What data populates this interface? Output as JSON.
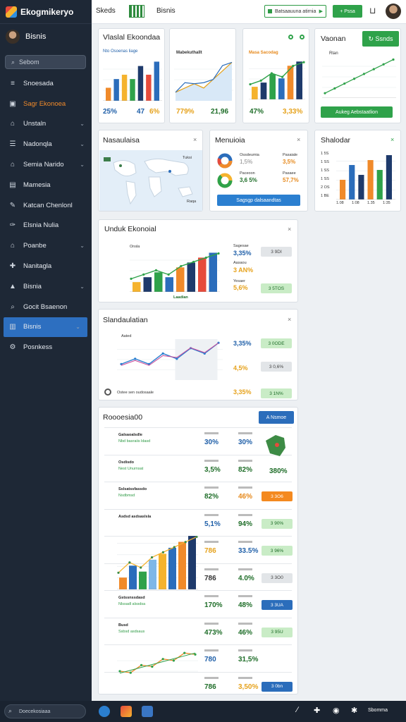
{
  "app": {
    "name": "Ekogmikeryo"
  },
  "profile": {
    "name": "Bisnis"
  },
  "sidebar": {
    "search_placeholder": "Sebom",
    "items": [
      {
        "label": "Snoesada",
        "icon": "list-icon"
      },
      {
        "label": "Sagr Ekonoea",
        "icon": "layers-icon"
      },
      {
        "label": "Unstaln",
        "icon": "home-icon"
      },
      {
        "label": "Nadonqla",
        "icon": "menu-icon"
      },
      {
        "label": "Semia Narido",
        "icon": "home-icon"
      },
      {
        "label": "Mamesia",
        "icon": "grid-icon"
      },
      {
        "label": "Katcan Chenlonl",
        "icon": "pen-icon"
      },
      {
        "label": "Elsnia Nulia",
        "icon": "pin-icon"
      },
      {
        "label": "Poanbe",
        "icon": "house-icon"
      },
      {
        "label": "Nanitagla",
        "icon": "puzzle-icon"
      },
      {
        "label": "Bisnia",
        "icon": "cap-icon"
      },
      {
        "label": "Gocit Bsaenon",
        "icon": "search-icon"
      },
      {
        "label": "Bisnis",
        "icon": "chart-icon"
      },
      {
        "label": "Posnkess",
        "icon": "gear-icon"
      }
    ]
  },
  "topbar": {
    "title": "Skeds",
    "page": "Bisnis",
    "input_value": "Batsaauuna atirnia",
    "action_label": "Pssa"
  },
  "cards": {
    "card1": {
      "title": "Vlaslal Ekoondaa",
      "subtitle": "Nto Osoenas liage",
      "values": [
        "25%",
        "47",
        "6%"
      ],
      "chart": {
        "type": "bar",
        "values": [
          3,
          5,
          6,
          5,
          8,
          6,
          9
        ]
      }
    },
    "card2": {
      "title": "Mabekuthallt",
      "values": [
        "779%",
        "21,96"
      ],
      "chart": {
        "type": "area",
        "values": [
          2,
          3,
          4,
          3,
          5,
          7,
          9
        ]
      }
    },
    "card3": {
      "title": "Masa Sacodag",
      "values": [
        "47%",
        "3,33%"
      ],
      "chart": {
        "type": "bar+line",
        "values": [
          3,
          4,
          6,
          5,
          8,
          9
        ]
      }
    },
    "card4": {
      "title": "Vaonan",
      "button": "Ssnds",
      "subtitle": "Rtan",
      "footer": "Aukeg Aebstaatlion",
      "chart": {
        "type": "line",
        "values": [
          1,
          2,
          3,
          4,
          5,
          6,
          7,
          8
        ]
      }
    },
    "map": {
      "title": "Nasaulaisa",
      "legend": "Tuksi",
      "label": "Raqa"
    },
    "donut": {
      "title": "Menuioia",
      "rows": [
        {
          "label": "Ossdeumia",
          "value": "1,5%"
        },
        {
          "label": "Paceoon",
          "value": "3,6 5%"
        }
      ],
      "right_labels": [
        "Pasaiale",
        "Pasaee"
      ],
      "right_values": [
        "3,5%",
        "57,7%"
      ],
      "button": "Sagsgp dalsaandtas"
    },
    "card6": {
      "title": "Shalodar",
      "yticks": [
        "1 5S",
        "1 SS",
        "1 SS",
        "1 SS",
        "2 OS",
        "1 BE"
      ],
      "xticks": [
        "1.08",
        "1:08",
        "1.35",
        "1:35"
      ],
      "chart": {
        "type": "bar",
        "values": [
          4,
          7,
          5,
          8,
          6,
          9
        ]
      }
    },
    "card7": {
      "title": "Unduk Ekonoial",
      "header": "Onsla",
      "xlabel": "Laadian",
      "values": [
        "3,35%",
        "3 AN%",
        "5,6%"
      ],
      "labels": [
        "Sagesae",
        "Aasaou",
        "Yesaer"
      ],
      "pills": [
        "3 9DI",
        "3 5TOS",
        "3 5TOS"
      ],
      "chart": {
        "type": "bar+line",
        "values": [
          2,
          3,
          4,
          3,
          5,
          6,
          7,
          8
        ]
      }
    },
    "card8": {
      "title": "Slandaulatian",
      "header": "Aated",
      "footer": "Ostee sen oudosaale",
      "values": [
        "3,35%",
        "4,5%",
        "3,35%"
      ],
      "pills": [
        "3 0ODE",
        "3 0,6%",
        "3 1N%"
      ],
      "chart": {
        "type": "line",
        "values": [
          3,
          4,
          3,
          5,
          4,
          6,
          5,
          7
        ]
      }
    },
    "table": {
      "title": "Roooesia00",
      "button": "A Nsmoe",
      "rows": [
        {
          "name": "Galsaoalsdle",
          "sub": "Nbd basraiis ldasd",
          "v1": "30%",
          "v2": "30%",
          "pill": null
        },
        {
          "name": "Osdisdo",
          "sub": "Nest Unurnsat",
          "v1": "3,5%",
          "v2": "82%",
          "pill": null,
          "extra": "380%"
        },
        {
          "name": "Sslsatssfassdo",
          "sub": "Nsdbmsd",
          "v1": "82%",
          "v2": "46%",
          "pill": "3 3O6"
        },
        {
          "name": "Asdsd asdsaslsla",
          "sub": "",
          "v1": "5,1%",
          "v2": "94%",
          "pill": "3 90%"
        },
        {
          "name": "",
          "sub": "",
          "v1": "786",
          "v2": "33.5%",
          "pill": "3 96%"
        },
        {
          "name": "",
          "sub": "",
          "v1": "786",
          "v2": "4.0%",
          "pill": "3 3O0"
        },
        {
          "name": "Gstssnssdasd",
          "sub": "Nlssadl alssdsa",
          "v1": "170%",
          "v2": "48%",
          "pill": "3 3UA"
        },
        {
          "name": "Busd",
          "sub": "Ssbsd asdsaus",
          "v1": "473%",
          "v2": "46%",
          "pill": "3 95U"
        },
        {
          "name": "",
          "sub": "",
          "v1": "780",
          "v2": "31,5%",
          "pill": null
        },
        {
          "name": "",
          "sub": "",
          "v1": "786",
          "v2": "3,50%",
          "pill": "3 0bn"
        }
      ],
      "bars": [
        2,
        4,
        3,
        5,
        6,
        7,
        8,
        9
      ],
      "line": [
        3,
        4,
        5,
        6,
        7,
        8,
        9,
        10
      ]
    }
  },
  "taskbar": {
    "search_placeholder": "Doecekosiaaa",
    "right_label": "Sbomma"
  },
  "colors": {
    "sidebar": "#1e2836",
    "active": "#2d6fc0",
    "green": "#2fa24a",
    "blue": "#1f5fa8",
    "orange": "#f08a2a",
    "navy": "#1e3a6b"
  }
}
